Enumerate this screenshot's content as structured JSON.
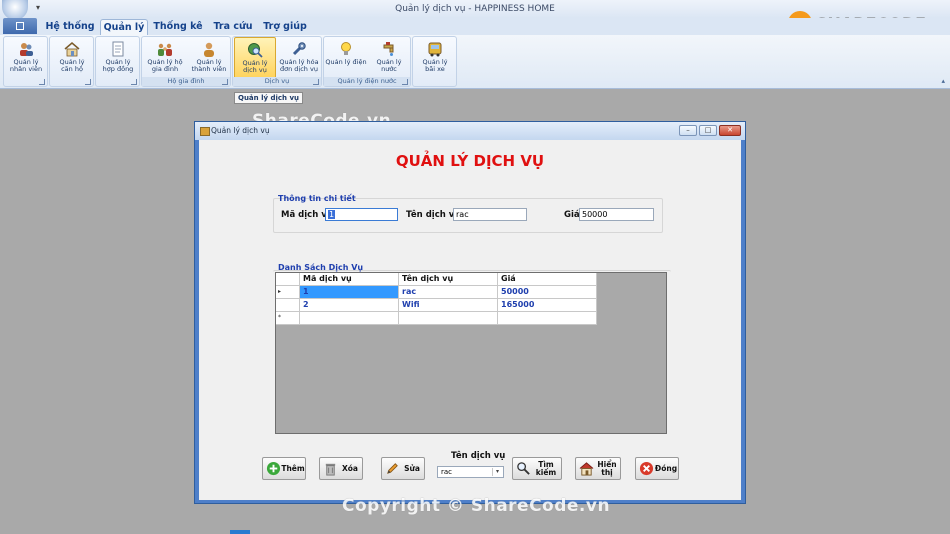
{
  "window": {
    "title": "Quản lý dịch vụ - HAPPINESS HOME"
  },
  "logo": {
    "text_main": "SHARECODE",
    "text_suffix": ".vn"
  },
  "menu_tabs": [
    "Hệ thống",
    "Quản lý",
    "Thống kê",
    "Tra cứu",
    "Trợ giúp"
  ],
  "active_tab": "Quản lý",
  "ribbon": {
    "buttons": [
      {
        "line1": "Quản lý",
        "line2": "nhân viên",
        "icon": "people-icon"
      },
      {
        "line1": "Quản lý",
        "line2": "căn hộ",
        "icon": "house-icon"
      },
      {
        "line1": "Quản lý",
        "line2": "hợp đồng",
        "icon": "document-icon"
      },
      {
        "line1": "Quản lý hộ",
        "line2": "gia đình",
        "icon": "family-icon"
      },
      {
        "line1": "Quản lý",
        "line2": "thành viên",
        "icon": "person-icon"
      },
      {
        "line1": "Quản lý",
        "line2": "dịch vụ",
        "icon": "globe-search-icon"
      },
      {
        "line1": "Quản lý hóa",
        "line2": "đơn dịch vụ",
        "icon": "wrench-icon"
      },
      {
        "line1": "Quản lý điện",
        "line2": "",
        "icon": "lightbulb-icon"
      },
      {
        "line1": "Quản lý",
        "line2": "nước",
        "icon": "faucet-icon"
      },
      {
        "line1": "Quản lý",
        "line2": "bãi xe",
        "icon": "bus-icon"
      }
    ],
    "group_labels": [
      "Hộ gia đình",
      "Dịch vụ",
      "Quản lý điện nước"
    ]
  },
  "tooltip": "Quản lý dịch vụ",
  "watermark": "ShareCode.vn",
  "watermark_bottom": "Copyright © ShareCode.vn",
  "dialog": {
    "title": "Quản lý dịch vụ",
    "heading": "QUẢN LÝ DỊCH VỤ",
    "details_group": "Thông tin chi tiết",
    "fields": {
      "ma_label": "Mã dịch vụ",
      "ma_value": "1",
      "ten_label": "Tên dịch vụ",
      "ten_value": "rac",
      "gia_label": "Giá",
      "gia_value": "50000"
    },
    "list_group": "Danh Sách Dịch Vụ",
    "table": {
      "columns": [
        "Mã dịch vụ",
        "Tên dịch vụ",
        "Giá"
      ],
      "rows": [
        [
          "1",
          "rac",
          "50000"
        ],
        [
          "2",
          "Wifi",
          "165000"
        ]
      ],
      "new_row_marker": "*",
      "current_row_marker": "▸"
    },
    "buttons": {
      "add": "Thêm",
      "delete": "Xóa",
      "edit": "Sửa",
      "search": "Tìm kiếm",
      "show": "Hiển thị",
      "close": "Đóng"
    },
    "combo_label": "Tên dịch vụ",
    "combo_value": "rac"
  },
  "colors": {
    "heading": "#e01010",
    "group_title": "#1f3fae",
    "ribbon_text": "#15428b",
    "selection": "#3399ff"
  }
}
